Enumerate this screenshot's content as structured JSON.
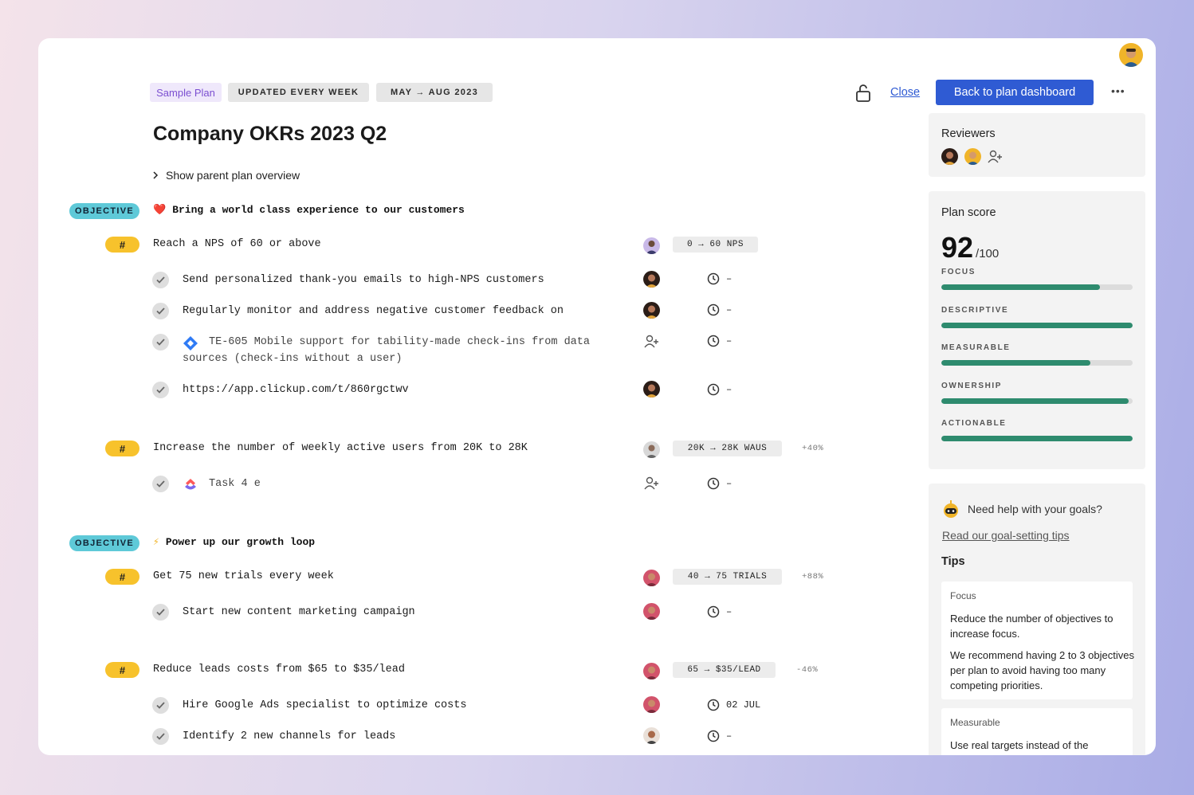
{
  "header": {
    "chips": [
      "Sample Plan",
      "UPDATED EVERY WEEK",
      "MAY → AUG 2023"
    ],
    "close_label": "Close",
    "back_label": "Back to plan dashboard",
    "more_label": "•••"
  },
  "plan": {
    "title": "Company OKRs 2023 Q2",
    "parent_toggle": "Show parent plan overview"
  },
  "labels": {
    "objective": "OBJECTIVE",
    "kr": "#",
    "dash": "–"
  },
  "objectives": [
    {
      "emoji": "❤️",
      "title": "Bring a world class experience to our customers",
      "krs": [
        {
          "title": "Reach a NPS of 60 or above",
          "metric": "0 → 60 NPS",
          "delta": "",
          "tasks": [
            {
              "title": "Send personalized thank-you emails to high-NPS customers",
              "due": "–"
            },
            {
              "title": "Regularly monitor and address negative customer feedback on",
              "due": "–"
            },
            {
              "title": "TE-605 Mobile support for tability-made check-ins from data",
              "title2": "sources (check-ins without a user)",
              "due": "–"
            },
            {
              "title": "https://app.clickup.com/t/860rgctwv",
              "due": "–"
            }
          ]
        },
        {
          "title": "Increase the number of weekly active users from 20K to 28K",
          "metric": "20K → 28K WAUS",
          "delta": "+40%",
          "tasks": [
            {
              "title": "Task 4 e",
              "due": "–"
            }
          ]
        }
      ]
    },
    {
      "emoji": "⚡",
      "title": "Power up our growth loop",
      "krs": [
        {
          "title": "Get 75 new trials every week",
          "metric": "40 → 75 TRIALS",
          "delta": "+88%",
          "tasks": [
            {
              "title": "Start new content marketing campaign",
              "due": "–"
            }
          ]
        },
        {
          "title": "Reduce leads costs from $65 to $35/lead",
          "metric": "65 → $35/LEAD",
          "delta": "-46%",
          "tasks": [
            {
              "title": "Hire Google Ads specialist to optimize costs",
              "due": "02 JUL"
            },
            {
              "title": "Identify 2 new channels for leads",
              "due": "–"
            }
          ]
        }
      ]
    }
  ],
  "reviewers": {
    "title": "Reviewers"
  },
  "score": {
    "title": "Plan score",
    "value": "92",
    "max": "/100",
    "criteria": [
      {
        "label": "FOCUS",
        "fill": 0.83
      },
      {
        "label": "DESCRIPTIVE",
        "fill": 1.0
      },
      {
        "label": "MEASURABLE",
        "fill": 0.78
      },
      {
        "label": "OWNERSHIP",
        "fill": 0.98
      },
      {
        "label": "ACTIONABLE",
        "fill": 1.0
      }
    ]
  },
  "help": {
    "question": "Need help with your goals?",
    "link": "Read our goal-setting tips",
    "tips_title": "Tips",
    "tips": [
      {
        "heading": "Focus",
        "p1": "Reduce the number of objectives to increase focus.",
        "p2": "We recommend having 2 to 3 objectives per plan to avoid having too many competing priorities."
      },
      {
        "heading": "Measurable",
        "p1": "Use real targets instead of the"
      }
    ]
  },
  "colors": {
    "accent": "#2f5bd3",
    "objective_badge": "#5ec9d8",
    "kr_badge": "#f7c22c",
    "score_bar": "#2e8b6e"
  }
}
